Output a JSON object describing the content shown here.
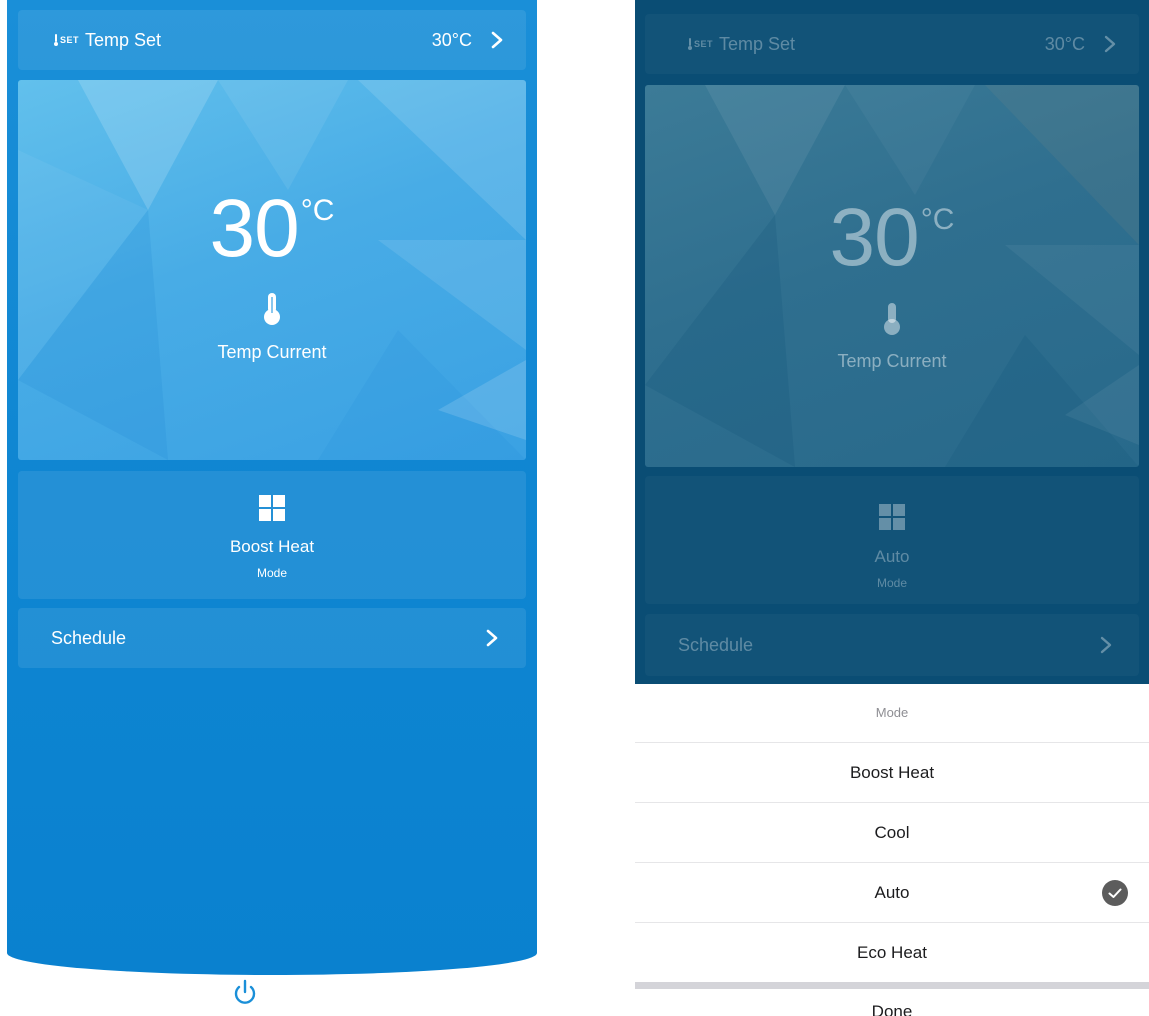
{
  "left_screen": {
    "temp_set": {
      "label": "Temp Set",
      "icon_text": "SET",
      "value": "30°C"
    },
    "hero": {
      "current_temp": "30",
      "unit": "°C",
      "label": "Temp Current"
    },
    "mode": {
      "value": "Boost Heat",
      "label": "Mode"
    },
    "schedule": {
      "label": "Schedule"
    }
  },
  "right_screen": {
    "temp_set": {
      "label": "Temp Set",
      "icon_text": "SET",
      "value": "30°C"
    },
    "hero": {
      "current_temp": "30",
      "unit": "°C",
      "label": "Temp Current"
    },
    "mode": {
      "value": "Auto",
      "label": "Mode"
    },
    "schedule": {
      "label": "Schedule"
    },
    "mode_sheet": {
      "title": "Mode",
      "options": [
        {
          "label": "Boost Heat",
          "selected": false
        },
        {
          "label": "Cool",
          "selected": false
        },
        {
          "label": "Auto",
          "selected": true
        },
        {
          "label": "Eco Heat",
          "selected": false
        }
      ],
      "done_label": "Done"
    }
  },
  "icons": {
    "set": "thermometer-set-icon",
    "chevron": "chevron-right-icon",
    "thermometer": "thermometer-icon",
    "mode": "grid-four-squares-icon",
    "power": "power-icon",
    "check": "checkmark-circle-icon"
  },
  "colors": {
    "primary_blue": "#1a8fd8",
    "hero_light": "#62c0ec",
    "overlay_dark": "#0a4d74",
    "check_gray": "#5c5c5c",
    "sheet_text": "#1c1c1e"
  }
}
